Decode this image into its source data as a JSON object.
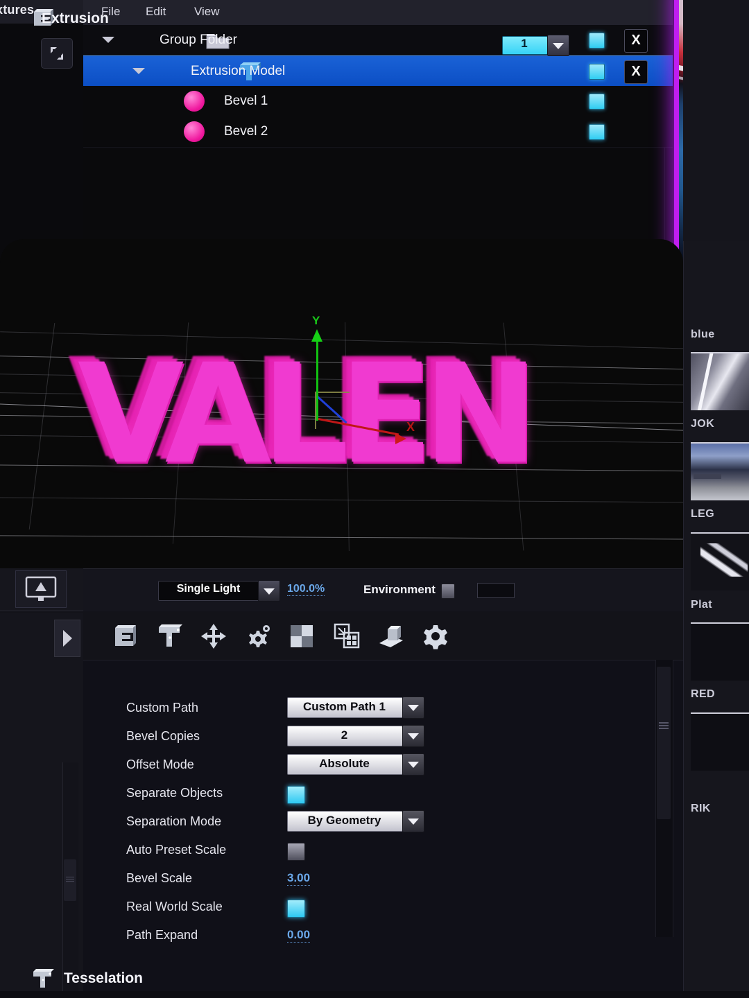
{
  "app": {
    "left_panel": {
      "title": "xtures",
      "expand_icon": "expand-window-icon",
      "monitor_icon": "monitor-icon",
      "arrow_icon": "play-arrow-icon"
    },
    "menubar": {
      "items": [
        {
          "label": "File"
        },
        {
          "label": "Edit"
        },
        {
          "label": "View"
        }
      ]
    },
    "outliner": {
      "rows": [
        {
          "label": "Group Folder",
          "icon": "folder-icon",
          "expanded": true,
          "selected": false,
          "count": "1",
          "has_x": true,
          "visible": true
        },
        {
          "label": "Extrusion Model",
          "icon": "extrusion-icon",
          "expanded": true,
          "selected": true,
          "count": "",
          "has_x": true,
          "visible": true
        },
        {
          "label": "Bevel 1",
          "icon": "material-sphere-icon",
          "expanded": false,
          "selected": false,
          "count": "",
          "has_x": false,
          "visible": true
        },
        {
          "label": "Bevel 2",
          "icon": "material-sphere-icon",
          "expanded": false,
          "selected": false,
          "count": "",
          "has_x": false,
          "visible": true
        }
      ],
      "close_label": "X"
    },
    "viewport": {
      "text_object": "VALEN",
      "axis": {
        "y": "Y",
        "x": "X"
      },
      "material_color": "#f03ad0",
      "background": "#090909"
    },
    "viewport_toolbar": {
      "light_mode": "Single Light",
      "light_intensity": "100.0%",
      "environment_label": "Environment",
      "environment_enabled": false
    },
    "attribute_manager": {
      "tab_icons": [
        "extrusion-icon",
        "tesselation-icon",
        "move-axis-icon",
        "deformer-gear-icon",
        "checker-material-icon",
        "copy-object-icon",
        "cap-object-icon",
        "settings-gear-icon"
      ],
      "groups": [
        {
          "title": "Extrusion",
          "icon": "extrusion-icon",
          "properties": [
            {
              "label": "Custom Path",
              "type": "combo",
              "value": "Custom Path 1"
            },
            {
              "label": "Bevel Copies",
              "type": "combo",
              "value": "2"
            },
            {
              "label": "Offset Mode",
              "type": "combo",
              "value": "Absolute"
            },
            {
              "label": "Separate Objects",
              "type": "checkbox",
              "value": "on"
            },
            {
              "label": "Separation Mode",
              "type": "combo",
              "value": "By Geometry"
            },
            {
              "label": "Auto Preset Scale",
              "type": "checkbox",
              "value": "off"
            },
            {
              "label": "Bevel Scale",
              "type": "number",
              "value": "3.00"
            },
            {
              "label": "Real World Scale",
              "type": "checkbox",
              "value": "on"
            },
            {
              "label": "Path Expand",
              "type": "number",
              "value": "0.00"
            }
          ]
        },
        {
          "title": "Tesselation",
          "icon": "tesselation-icon",
          "properties": []
        }
      ]
    },
    "material_browser": {
      "items": [
        {
          "name": "blue"
        },
        {
          "name": "JOK"
        },
        {
          "name": "LEG"
        },
        {
          "name": "Plat"
        },
        {
          "name": "RED"
        },
        {
          "name": "RIK"
        }
      ]
    },
    "preview_card": {
      "name": "video-thumbnail-preview",
      "border_color": "#c01ef0"
    }
  }
}
